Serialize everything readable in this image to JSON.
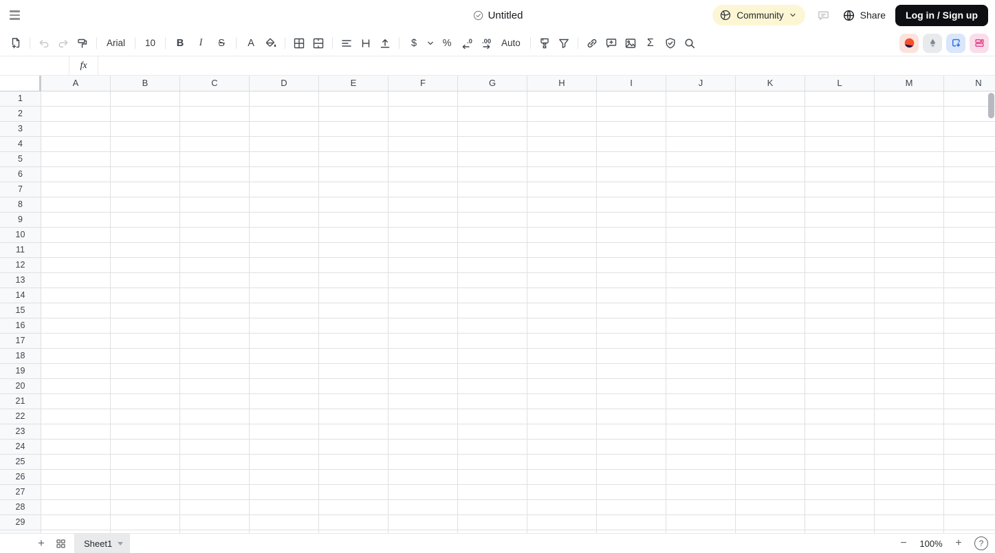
{
  "topbar": {
    "title": "Untitled",
    "community_label": "Community",
    "share_label": "Share",
    "login_label": "Log in / Sign up"
  },
  "toolbar": {
    "font_family": "Arial",
    "font_size": "10",
    "bold_label": "B",
    "italic_label": "I",
    "strikethrough_label": "S",
    "text_color_label": "A",
    "currency_label": "$",
    "percent_label": "%",
    "decrease_decimal_label": ".0",
    "increase_decimal_label": ".00",
    "auto_format_label": "Auto",
    "sum_label": "Σ"
  },
  "formula_bar": {
    "fx_label": "fx",
    "name_box_value": "",
    "formula_value": ""
  },
  "grid": {
    "column_headers": [
      "A",
      "B",
      "C",
      "D",
      "E",
      "F",
      "G",
      "H",
      "I",
      "J",
      "K",
      "L",
      "M",
      "N"
    ],
    "row_headers": [
      "1",
      "2",
      "3",
      "4",
      "5",
      "6",
      "7",
      "8",
      "9",
      "10",
      "11",
      "12",
      "13",
      "14",
      "15",
      "16",
      "17",
      "18",
      "19",
      "20",
      "21",
      "22",
      "23",
      "24",
      "25",
      "26",
      "27",
      "28",
      "29"
    ]
  },
  "sheet_bar": {
    "add_sheet_label": "+",
    "tabs": [
      {
        "label": "Sheet1"
      }
    ],
    "zoom_out_label": "−",
    "zoom_level": "100%",
    "zoom_in_label": "+",
    "help_label": "?"
  },
  "colors": {
    "community_bg": "#fcf6d4",
    "login_bg": "#0d0f12",
    "grid_line": "#dee0e3",
    "header_bg": "#f8f9fa",
    "plugin_sun_bg": "#fbe3dd",
    "plugin_sun_orange": "#f4512c",
    "plugin_sun_navy": "#1e1b53",
    "plugin_eth_bg": "#e8eaec",
    "plugin_eth_fg": "#7d8799",
    "plugin_import_bg": "#d9e6fb",
    "plugin_import_fg": "#2e6be6",
    "plugin_blocks_bg": "#fbdcea",
    "plugin_blocks_fg": "#e0498f"
  }
}
